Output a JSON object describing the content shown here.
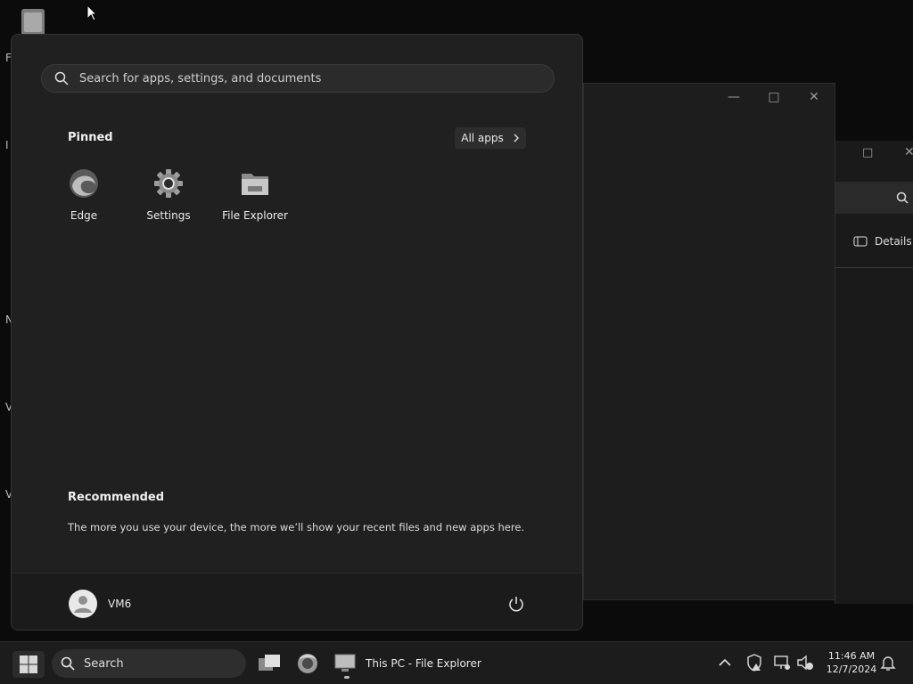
{
  "start_menu": {
    "search_placeholder": "Search for apps, settings, and documents",
    "pinned_title": "Pinned",
    "all_apps_label": "All apps",
    "pinned_apps": [
      {
        "label": "Edge",
        "icon": "edge-icon"
      },
      {
        "label": "Settings",
        "icon": "gear-icon"
      },
      {
        "label": "File Explorer",
        "icon": "folder-icon"
      }
    ],
    "recommended_title": "Recommended",
    "recommended_text": "The more you use your device, the more we’ll show your recent files and new apps here.",
    "user_name": "VM6"
  },
  "background_window": {
    "details_label": "Details"
  },
  "desktop": {
    "side_letters": [
      "F",
      "I",
      "N",
      "V",
      "V"
    ]
  },
  "taskbar": {
    "search_label": "Search",
    "open_app_label": "This PC - File Explorer",
    "time": "11:46 AM",
    "date": "12/7/2024"
  }
}
